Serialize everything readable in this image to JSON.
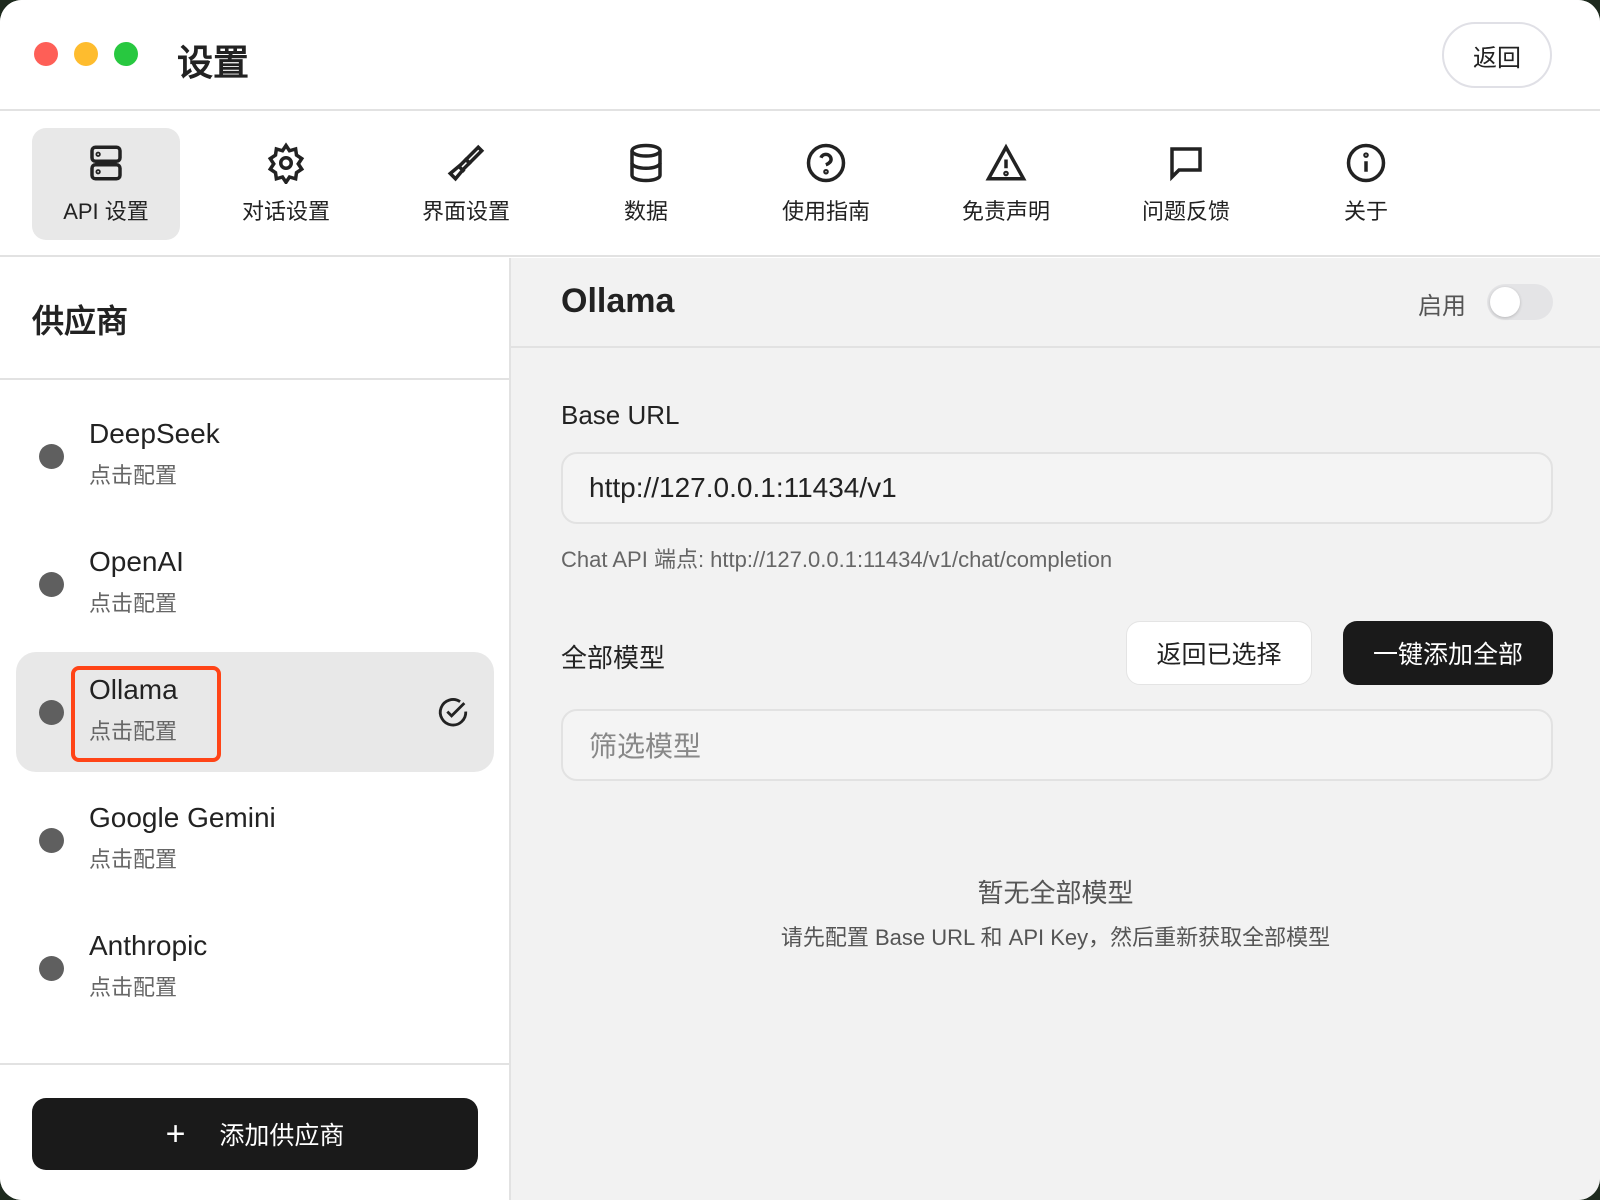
{
  "window": {
    "title": "设置",
    "back_label": "返回"
  },
  "tabs": [
    {
      "label": "API 设置",
      "icon": "server-icon"
    },
    {
      "label": "对话设置",
      "icon": "gear-icon"
    },
    {
      "label": "界面设置",
      "icon": "paintbrush-icon"
    },
    {
      "label": "数据",
      "icon": "database-icon"
    },
    {
      "label": "使用指南",
      "icon": "help-circle-icon"
    },
    {
      "label": "免责声明",
      "icon": "warning-icon"
    },
    {
      "label": "问题反馈",
      "icon": "message-icon"
    },
    {
      "label": "关于",
      "icon": "info-icon"
    }
  ],
  "sidebar": {
    "title": "供应商",
    "add_label": "添加供应商",
    "providers": [
      {
        "name": "DeepSeek",
        "status": "点击配置"
      },
      {
        "name": "OpenAI",
        "status": "点击配置"
      },
      {
        "name": "Ollama",
        "status": "点击配置",
        "selected": true
      },
      {
        "name": "Google Gemini",
        "status": "点击配置"
      },
      {
        "name": "Anthropic",
        "status": "点击配置"
      }
    ]
  },
  "main": {
    "title": "Ollama",
    "enable_label": "启用",
    "enabled": false,
    "base_url_label": "Base URL",
    "base_url_value": "http://127.0.0.1:11434/v1",
    "endpoint_hint": "Chat API 端点: http://127.0.0.1:11434/v1/chat/completion",
    "models_label": "全部模型",
    "back_selected_label": "返回已选择",
    "add_all_label": "一键添加全部",
    "filter_placeholder": "筛选模型",
    "empty_title": "暂无全部模型",
    "empty_desc": "请先配置 Base URL 和 API Key，然后重新获取全部模型"
  }
}
